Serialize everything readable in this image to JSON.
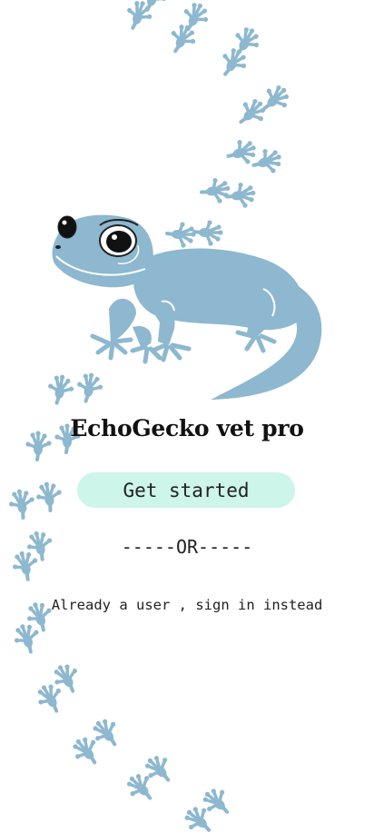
{
  "app": {
    "title": "EchoGecko vet pro"
  },
  "actions": {
    "get_started_label": "Get started",
    "divider_text": "-----OR-----",
    "signin_text": "Already a user , sign in instead"
  },
  "icons": {
    "mascot": "gecko-illustration",
    "footprint": "gecko-footprint-icon"
  },
  "colors": {
    "gecko": "#8db8cf",
    "footprint": "#8db8cf",
    "button_bg": "#cdf5ea",
    "text": "#111111"
  }
}
